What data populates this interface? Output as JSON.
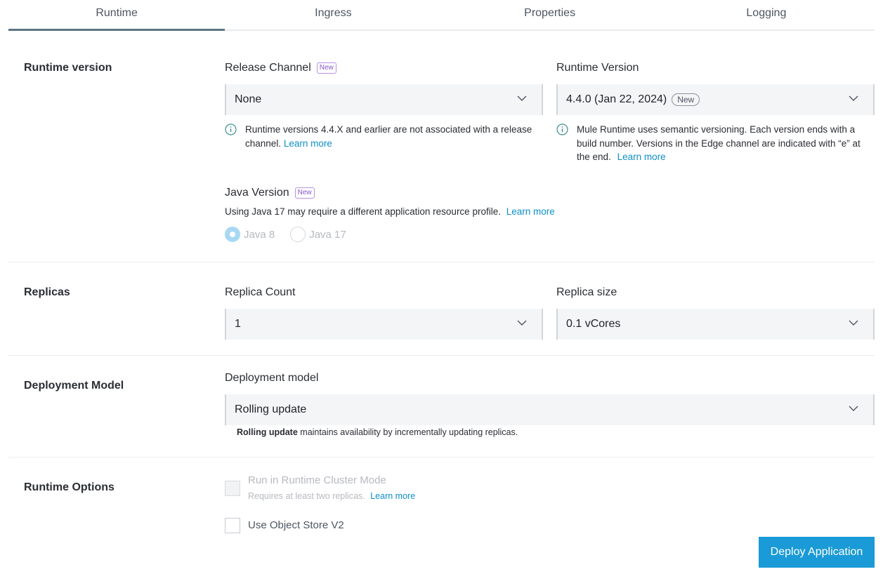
{
  "tabs": [
    {
      "label": "Runtime",
      "active": true
    },
    {
      "label": "Ingress",
      "active": false
    },
    {
      "label": "Properties",
      "active": false
    },
    {
      "label": "Logging",
      "active": false
    }
  ],
  "runtime_version": {
    "section_title": "Runtime version",
    "release_channel": {
      "label": "Release Channel",
      "badge": "New",
      "value": "None",
      "help": "Runtime versions 4.4.X and earlier are not associated with a release channel.",
      "help_link": "Learn more"
    },
    "runtime_version_field": {
      "label": "Runtime Version",
      "value": "4.4.0 (Jan 22, 2024)",
      "value_badge": "New",
      "help": "Mule Runtime uses semantic versioning. Each version ends with a build number. Versions in the Edge channel are indicated with “e” at the end.",
      "help_link": "Learn more"
    },
    "java_version": {
      "label": "Java Version",
      "badge": "New",
      "note": "Using Java 17 may require a different application resource profile.",
      "note_link": "Learn more",
      "options": [
        {
          "label": "Java 8",
          "checked": true
        },
        {
          "label": "Java 17",
          "checked": false
        }
      ]
    }
  },
  "replicas": {
    "section_title": "Replicas",
    "count": {
      "label": "Replica Count",
      "value": "1"
    },
    "size": {
      "label": "Replica size",
      "value": "0.1 vCores"
    }
  },
  "deployment_model": {
    "section_title": "Deployment Model",
    "label": "Deployment model",
    "value": "Rolling update",
    "help_bold": "Rolling update",
    "help_rest": " maintains availability by incrementally updating replicas."
  },
  "runtime_options": {
    "section_title": "Runtime Options",
    "cluster_mode": {
      "label": "Run in Runtime Cluster Mode",
      "sublabel": "Requires at least two replicas.",
      "sublabel_link": "Learn more",
      "disabled": true
    },
    "object_store": {
      "label": "Use Object Store V2",
      "checked": false
    }
  },
  "actions": {
    "deploy_label": "Deploy Application"
  },
  "colors": {
    "accent": "#1a9ad6",
    "link": "#0d8fc7",
    "badge_purple": "#8a55c7"
  }
}
